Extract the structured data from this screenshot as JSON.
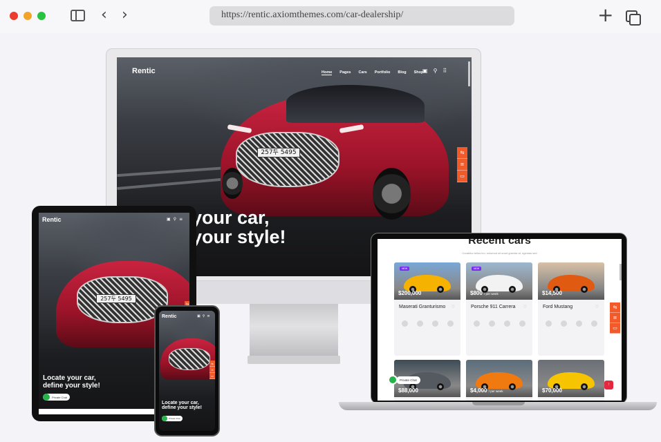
{
  "browser": {
    "url": "https://rentic.axiomthemes.com/car-dealership/",
    "icons": [
      "sidebar-icon",
      "back-icon",
      "forward-icon",
      "new-tab-icon",
      "tabs-overview-icon"
    ]
  },
  "site": {
    "logo": "Rentic",
    "nav": [
      "Home",
      "Pages",
      "Cars",
      "Portfolio",
      "Blog",
      "Shop"
    ],
    "active_nav": "Home",
    "plate": "257두 5495",
    "desktop_headline": [
      "your car,",
      "your style!"
    ],
    "mobile_headline": [
      "Locate your car,",
      "define your style!"
    ],
    "chat_label": "Private Chat",
    "accent": "#f35a2a"
  },
  "laptop": {
    "section_title": "Recent cars",
    "section_subtitle": "Curabitur tellus leo, euismod sit amet gravida at, egestas sed",
    "cards": [
      {
        "name": "Maserati Granturismo",
        "price": "$200,000",
        "period": "",
        "badge": "NEW",
        "color": "#f6b200",
        "bg": "#7aa7d6"
      },
      {
        "name": "Porsche 911 Carrera",
        "price": "$800",
        "period": "/ per week",
        "badge": "NEW",
        "color": "#f2f2f2",
        "bg": "#9cb7d0"
      },
      {
        "name": "Ford Mustang",
        "price": "$14,500",
        "period": "",
        "badge": "",
        "color": "#e05a12",
        "bg": "#d7c0a6"
      },
      {
        "name": "",
        "price": "$88,000",
        "period": "",
        "badge": "",
        "color": "#555a60",
        "bg": "#3d4b55"
      },
      {
        "name": "",
        "price": "$4,000",
        "period": "/ per week",
        "badge": "",
        "color": "#f07a10",
        "bg": "#5b6d7c"
      },
      {
        "name": "",
        "price": "$70,000",
        "period": "",
        "badge": "",
        "color": "#f6c400",
        "bg": "#6b6f76"
      }
    ]
  }
}
